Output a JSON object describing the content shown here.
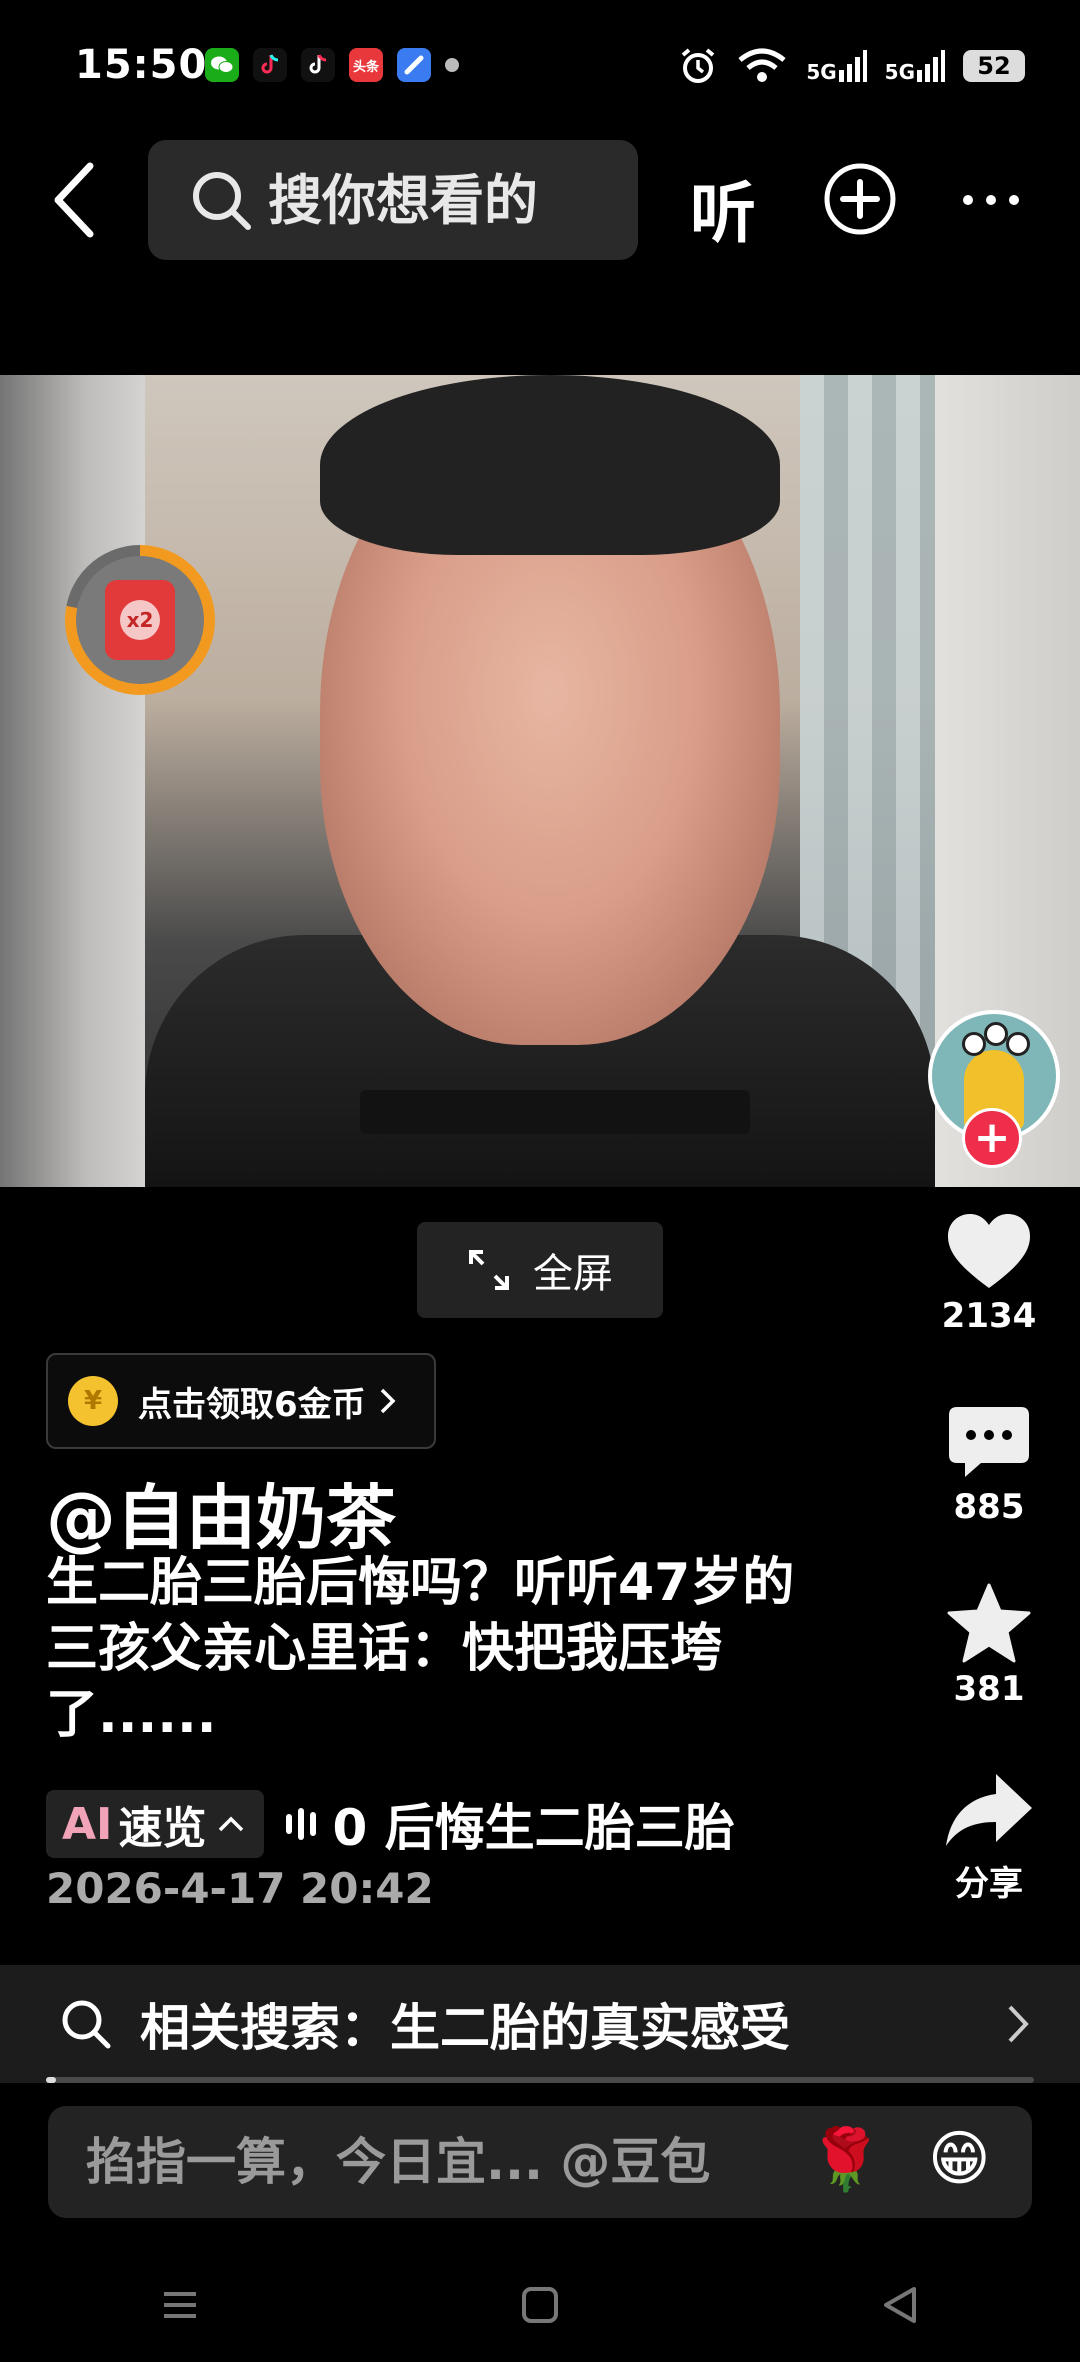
{
  "status_bar": {
    "time": "15:50",
    "notification_icons": [
      "wechat-icon",
      "douyin-lite-icon",
      "tiktok-icon",
      "toutiao-icon",
      "blue-app-icon"
    ],
    "network_1": "5G",
    "network_2": "5G",
    "battery": "52"
  },
  "top_nav": {
    "search_placeholder": "搜你想看的",
    "listen_label": "听"
  },
  "video": {
    "fullscreen_label": "全屏",
    "reward_multiplier": "x2"
  },
  "actions": {
    "like_count": "2134",
    "comment_count": "885",
    "favorite_count": "381",
    "share_label": "分享"
  },
  "post": {
    "coin_banner": "点击领取6金币",
    "coin_symbol": "¥",
    "username": "@自由奶茶",
    "caption": "生二胎三胎后悔吗？听听47岁的三孩父亲心里话：快把我压垮了......",
    "ai_prefix": "AI",
    "ai_label": "速览",
    "ai_topic": "0 后悔生二胎三胎",
    "timestamp": "2026-4-17 20:42"
  },
  "related_search": {
    "text": "相关搜索：生二胎的真实感受"
  },
  "playback": {
    "progress": 0.01
  },
  "comment": {
    "placeholder": "掐指一算，今日宜... @豆包",
    "emoji_1": "🌹",
    "emoji_2": "😁"
  }
}
